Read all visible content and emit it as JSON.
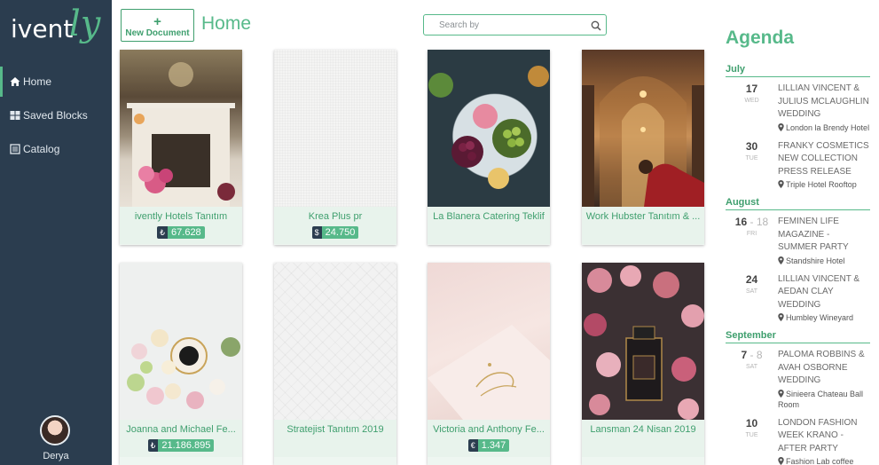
{
  "brand": {
    "logo_left": "ivent",
    "logo_right": "ly"
  },
  "nav": {
    "items": [
      {
        "label": "Home",
        "icon": "home-icon",
        "active": true
      },
      {
        "label": "Saved Blocks",
        "icon": "grid-icon"
      },
      {
        "label": "Catalog",
        "icon": "catalog-icon"
      }
    ]
  },
  "user": {
    "name": "Derya"
  },
  "toolbar": {
    "new_doc_plus": "+",
    "new_doc_label": "New Document"
  },
  "page": {
    "title": "Home"
  },
  "search": {
    "placeholder": "Search by",
    "icon": "search-icon"
  },
  "documents": [
    {
      "title": "ivently Hotels Tanıtım",
      "currency": "₺",
      "amount": "67.628"
    },
    {
      "title": "Krea Plus pr",
      "currency": "$",
      "amount": "24.750"
    },
    {
      "title": "La Blanera Catering Teklif"
    },
    {
      "title": "Work Hubster Tanıtım & ..."
    },
    {
      "title": "Joanna and Michael Fe...",
      "currency": "₺",
      "amount": "21.186.895"
    },
    {
      "title": "Stratejist Tanıtım 2019"
    },
    {
      "title": "Victoria and Anthony Fe...",
      "currency": "€",
      "amount": "1.347"
    },
    {
      "title": "Lansman 24 Nisan 2019"
    }
  ],
  "agenda": {
    "title": "Agenda",
    "months": [
      {
        "name": "July",
        "events": [
          {
            "day": "17",
            "dow": "WED",
            "name": "LILLIAN VINCENT & JULIUS MCLAUGHLIN WEDDING",
            "location": "London la Brendy Hotel"
          },
          {
            "day": "30",
            "dow": "TUE",
            "name": "FRANKY COSMETICS NEW COLLECTION PRESS RELEASE",
            "location": "Triple Hotel Rooftop"
          }
        ]
      },
      {
        "name": "August",
        "events": [
          {
            "day": "16",
            "day_to": "- 18",
            "dow": "FRI",
            "name": "FEMINEN LIFE MAGAZINE - SUMMER PARTY",
            "location": "Standshire Hotel"
          },
          {
            "day": "24",
            "dow": "SAT",
            "name": "LILLIAN VINCENT & AEDAN CLAY WEDDING",
            "location": "Humbley Wineyard"
          }
        ]
      },
      {
        "name": "September",
        "events": [
          {
            "day": "7",
            "day_to": "- 8",
            "dow": "SAT",
            "name": "PALOMA ROBBINS & AVAH OSBORNE WEDDING",
            "location": "Sinieera Chateau Ball Room"
          },
          {
            "day": "10",
            "dow": "TUE",
            "name": "LONDON FASHION WEEK KRANO - AFTER PARTY",
            "location": "Fashion Lab coffee"
          }
        ]
      }
    ]
  },
  "colors": {
    "sidebar": "#2b3d4f",
    "accent": "#57b98a",
    "accent_dark": "#3f9f6e"
  }
}
